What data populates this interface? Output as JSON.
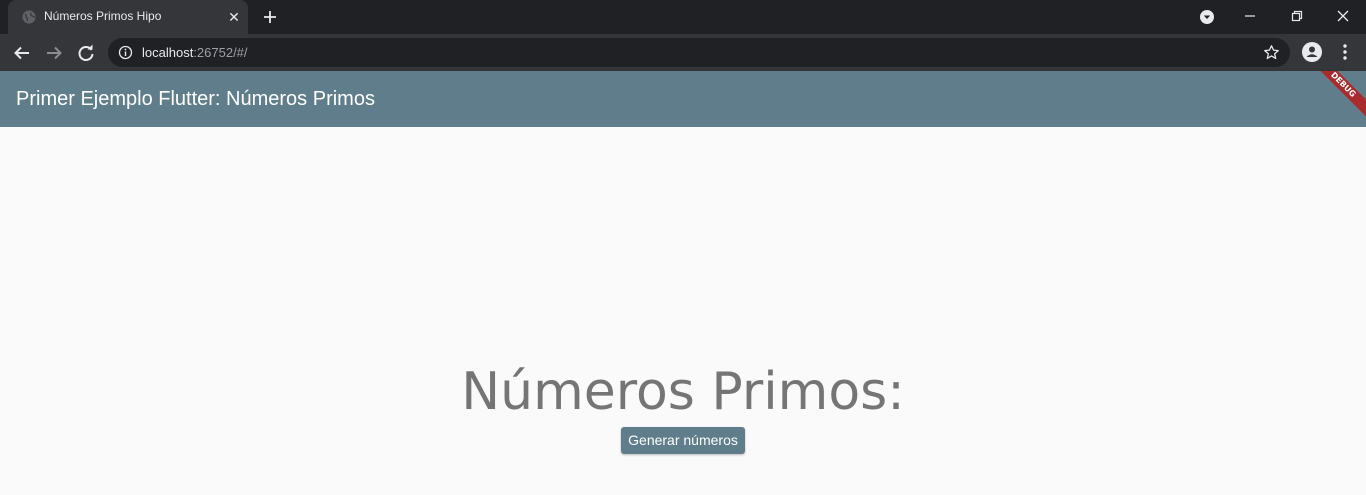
{
  "browser": {
    "tab_title": "Números Primos Hipo",
    "tab_close_glyph": "✕",
    "url_host": "localhost",
    "url_rest": ":26752/#/",
    "icons": [
      "globe-icon",
      "close-icon",
      "plus-icon",
      "chevron-down-icon",
      "minimize-icon",
      "restore-icon",
      "close-icon",
      "arrow-left-icon",
      "arrow-right-icon",
      "reload-icon",
      "info-icon",
      "star-icon",
      "account-icon",
      "more-vert-icon"
    ]
  },
  "app": {
    "title": "Primer Ejemplo Flutter: Números Primos",
    "debug_banner": "DEBUG",
    "heading": "Números Primos:",
    "generate_button": "Generar números",
    "colors": {
      "primary": "#607d8b",
      "background": "#fafafa",
      "heading_text": "#757575",
      "debug_banner": "#b71c1c"
    }
  }
}
